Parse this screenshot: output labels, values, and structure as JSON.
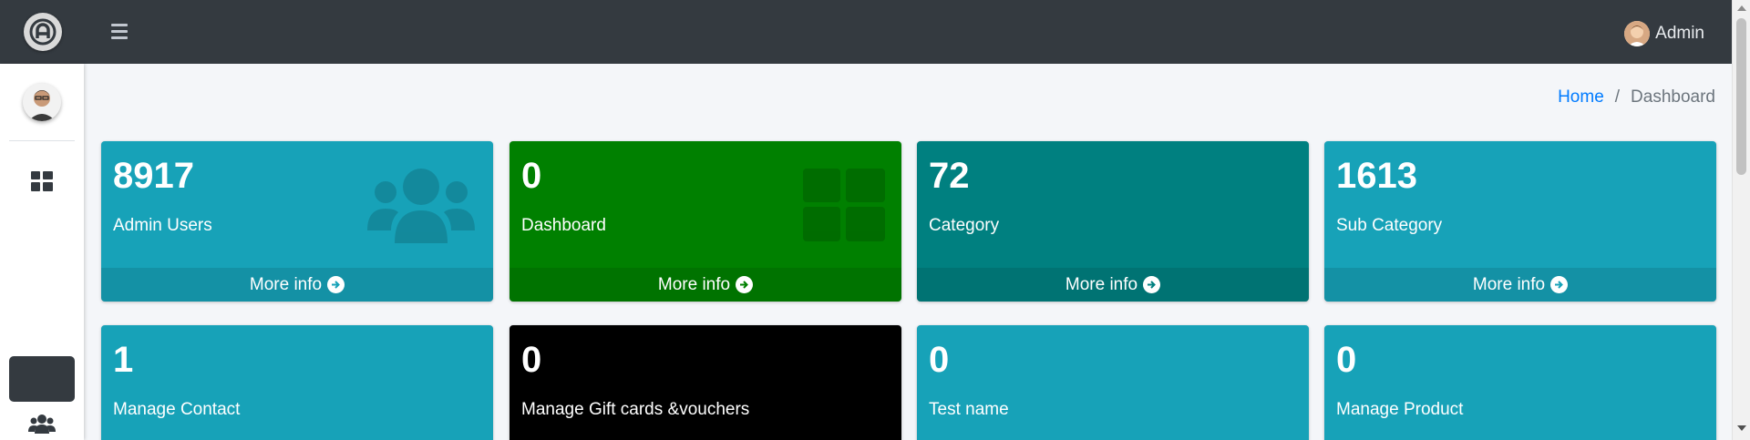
{
  "colors": {
    "navbar": "#343a40",
    "info": "#17a2b8",
    "success": "#008000",
    "teal": "#008080",
    "black": "#000000",
    "link": "#007bff"
  },
  "navbar": {
    "brand_icon": "brand-logo-icon",
    "menu_icon": "hamburger-icon",
    "user_name": "Admin"
  },
  "breadcrumb": {
    "home": "Home",
    "separator": "/",
    "current": "Dashboard"
  },
  "sidebar": {
    "items": [
      {
        "icon": "dashboard-grid-icon"
      },
      {
        "icon": "active-menu-item"
      },
      {
        "icon": "users-icon"
      }
    ]
  },
  "boxes": [
    {
      "value": "8917",
      "label": "Admin Users",
      "footer": "More info",
      "color": "#17a2b8",
      "icon": "users-icon"
    },
    {
      "value": "0",
      "label": "Dashboard",
      "footer": "More info",
      "color": "#008000",
      "icon": "dashboard-grid-icon"
    },
    {
      "value": "72",
      "label": "Category",
      "footer": "More info",
      "color": "#008080",
      "icon": ""
    },
    {
      "value": "1613",
      "label": "Sub Category",
      "footer": "More info",
      "color": "#17a2b8",
      "icon": ""
    },
    {
      "value": "1",
      "label": "Manage Contact",
      "color": "#17a2b8"
    },
    {
      "value": "0",
      "label": "Manage Gift cards &vouchers",
      "color": "#000000"
    },
    {
      "value": "0",
      "label": "Test name",
      "color": "#17a2b8"
    },
    {
      "value": "0",
      "label": "Manage Product",
      "color": "#17a2b8"
    }
  ]
}
